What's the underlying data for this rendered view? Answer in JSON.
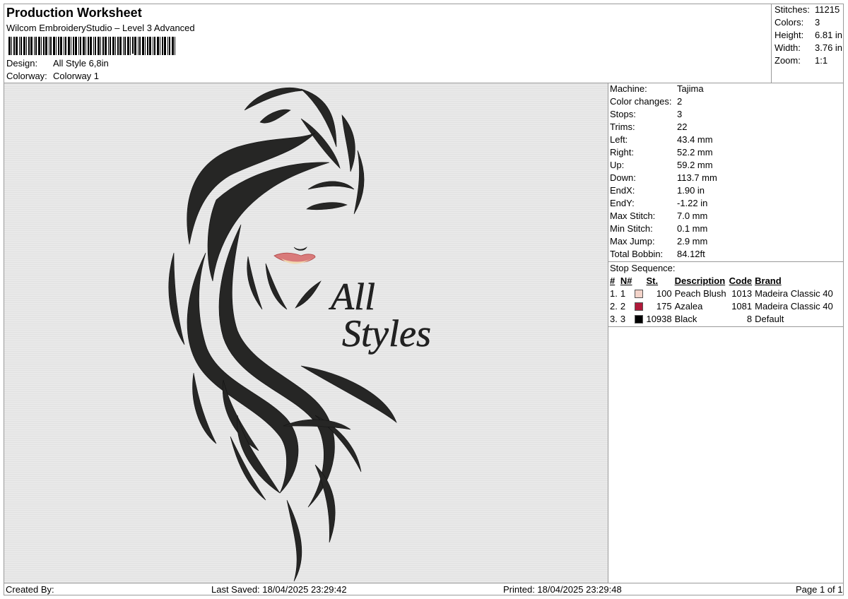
{
  "header": {
    "title": "Production Worksheet",
    "subtitle": "Wilcom EmbroideryStudio – Level 3 Advanced",
    "barcode_icon": "barcode-icon",
    "design_label": "Design:",
    "design_value": "All Style 6,8in",
    "colorway_label": "Colorway:",
    "colorway_value": "Colorway 1"
  },
  "stats": [
    {
      "label": "Stitches:",
      "value": "11215"
    },
    {
      "label": "Colors:",
      "value": "3"
    },
    {
      "label": "Height:",
      "value": "6.81 in"
    },
    {
      "label": "Width:",
      "value": "3.76 in"
    },
    {
      "label": "Zoom:",
      "value": "1:1"
    }
  ],
  "params": [
    {
      "label": "Machine:",
      "value": "Tajima"
    },
    {
      "label": "Color changes:",
      "value": "2"
    },
    {
      "label": "Stops:",
      "value": "3"
    },
    {
      "label": "Trims:",
      "value": "22"
    },
    {
      "label": "Left:",
      "value": "43.4 mm"
    },
    {
      "label": "Right:",
      "value": "52.2 mm"
    },
    {
      "label": "Up:",
      "value": "59.2 mm"
    },
    {
      "label": "Down:",
      "value": "113.7 mm"
    },
    {
      "label": "EndX:",
      "value": "1.90 in"
    },
    {
      "label": "EndY:",
      "value": "-1.22 in"
    },
    {
      "label": "Max Stitch:",
      "value": "7.0 mm"
    },
    {
      "label": "Min Stitch:",
      "value": "0.1 mm"
    },
    {
      "label": "Max Jump:",
      "value": "2.9 mm"
    },
    {
      "label": "Total Bobbin:",
      "value": "84.12ft"
    }
  ],
  "stop_sequence": {
    "title": "Stop Sequence:",
    "headers": {
      "num": "#",
      "n": "N#",
      "st": "St.",
      "desc": "Description",
      "code": "Code",
      "brand": "Brand"
    },
    "rows": [
      {
        "num": "1.",
        "n": "1",
        "color": "#f3d3c9",
        "st": "100",
        "desc": "Peach Blush",
        "code": "1013",
        "brand": "Madeira Classic 40"
      },
      {
        "num": "2.",
        "n": "2",
        "color": "#b0193a",
        "st": "175",
        "desc": "Azalea",
        "code": "1081",
        "brand": "Madeira Classic 40"
      },
      {
        "num": "3.",
        "n": "3",
        "color": "#000000",
        "st": "10938",
        "desc": "Black",
        "code": "8",
        "brand": "Default"
      }
    ]
  },
  "design_text": {
    "line1": "All",
    "line2": "Styles"
  },
  "footer": {
    "created_by": "Created By:",
    "last_saved": "Last Saved: 18/04/2025 23:29:42",
    "printed": "Printed: 18/04/2025 23:29:48",
    "page": "Page 1 of 1"
  }
}
